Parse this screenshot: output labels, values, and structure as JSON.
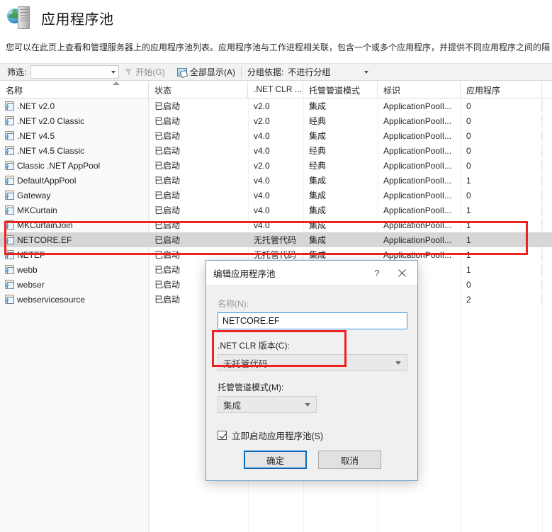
{
  "page": {
    "title": "应用程序池",
    "icon": "server-globe-icon",
    "description": "您可以在此页上查看和管理服务器上的应用程序池列表。应用程序池与工作进程相关联，包含一个或多个应用程序，并提供不同应用程序之间的隔"
  },
  "toolbar": {
    "filter_label": "筛选:",
    "filter_value": "",
    "filter_placeholder": "",
    "start_label": "开始(G)",
    "start_icon": "funnel-icon",
    "show_all_label": "全部显示(A)",
    "show_all_icon": "show-all-icon",
    "group_by_label": "分组依据:",
    "group_by_value": "不进行分组",
    "separator_dot": "·"
  },
  "grid": {
    "columns": [
      {
        "key": "name",
        "label": "名称",
        "sorted": true
      },
      {
        "key": "state",
        "label": "状态",
        "sorted": false
      },
      {
        "key": "clr",
        "label": ".NET CLR ...",
        "sorted": false
      },
      {
        "key": "mode",
        "label": "托管管道模式",
        "sorted": false
      },
      {
        "key": "ident",
        "label": "标识",
        "sorted": false
      },
      {
        "key": "apps",
        "label": "应用程序",
        "sorted": false
      }
    ],
    "rows": [
      {
        "name": ".NET v2.0",
        "state": "已启动",
        "clr": "v2.0",
        "mode": "集成",
        "ident": "ApplicationPoolI...",
        "apps": "0",
        "selected": false
      },
      {
        "name": ".NET v2.0 Classic",
        "state": "已启动",
        "clr": "v2.0",
        "mode": "经典",
        "ident": "ApplicationPoolI...",
        "apps": "0",
        "selected": false
      },
      {
        "name": ".NET v4.5",
        "state": "已启动",
        "clr": "v4.0",
        "mode": "集成",
        "ident": "ApplicationPoolI...",
        "apps": "0",
        "selected": false
      },
      {
        "name": ".NET v4.5 Classic",
        "state": "已启动",
        "clr": "v4.0",
        "mode": "经典",
        "ident": "ApplicationPoolI...",
        "apps": "0",
        "selected": false
      },
      {
        "name": "Classic .NET AppPool",
        "state": "已启动",
        "clr": "v2.0",
        "mode": "经典",
        "ident": "ApplicationPoolI...",
        "apps": "0",
        "selected": false
      },
      {
        "name": "DefaultAppPool",
        "state": "已启动",
        "clr": "v4.0",
        "mode": "集成",
        "ident": "ApplicationPoolI...",
        "apps": "1",
        "selected": false
      },
      {
        "name": "Gateway",
        "state": "已启动",
        "clr": "v4.0",
        "mode": "集成",
        "ident": "ApplicationPoolI...",
        "apps": "0",
        "selected": false
      },
      {
        "name": "MKCurtain",
        "state": "已启动",
        "clr": "v4.0",
        "mode": "集成",
        "ident": "ApplicationPoolI...",
        "apps": "1",
        "selected": false
      },
      {
        "name": "MKCurtainJoin",
        "state": "已启动",
        "clr": "v4.0",
        "mode": "集成",
        "ident": "ApplicationPoolI...",
        "apps": "1",
        "selected": false
      },
      {
        "name": "NETCORE.EF",
        "state": "已启动",
        "clr": "无托管代码",
        "mode": "集成",
        "ident": "ApplicationPoolI...",
        "apps": "1",
        "selected": true
      },
      {
        "name": "NETEF",
        "state": "已启动",
        "clr": "无托管代码",
        "mode": "集成",
        "ident": "ApplicationPoolI...",
        "apps": "1",
        "selected": false
      },
      {
        "name": "webb",
        "state": "已启动",
        "clr": "",
        "mode": "",
        "ident": "nPoolI...",
        "apps": "1",
        "selected": false
      },
      {
        "name": "webser",
        "state": "已启动",
        "clr": "",
        "mode": "",
        "ident": "nPoolI...",
        "apps": "0",
        "selected": false
      },
      {
        "name": "webservicesource",
        "state": "已启动",
        "clr": "",
        "mode": "",
        "ident": "nPoolI...",
        "apps": "2",
        "selected": false
      }
    ]
  },
  "dialog": {
    "title": "编辑应用程序池",
    "help_label": "?",
    "close_icon": "close-icon",
    "name_label": "名称(N):",
    "name_value": "NETCORE.EF",
    "clr_label": ".NET CLR 版本(C):",
    "clr_value": "无托管代码",
    "pipeline_label": "托管管道模式(M):",
    "pipeline_value": "集成",
    "start_now_label": "立即启动应用程序池(S)",
    "start_now_checked": true,
    "ok_label": "确定",
    "cancel_label": "取消"
  },
  "annotations": {
    "highlight_color": "#ee2222",
    "boxes": [
      "selected-rows-highlight",
      "clr-version-highlight"
    ]
  }
}
